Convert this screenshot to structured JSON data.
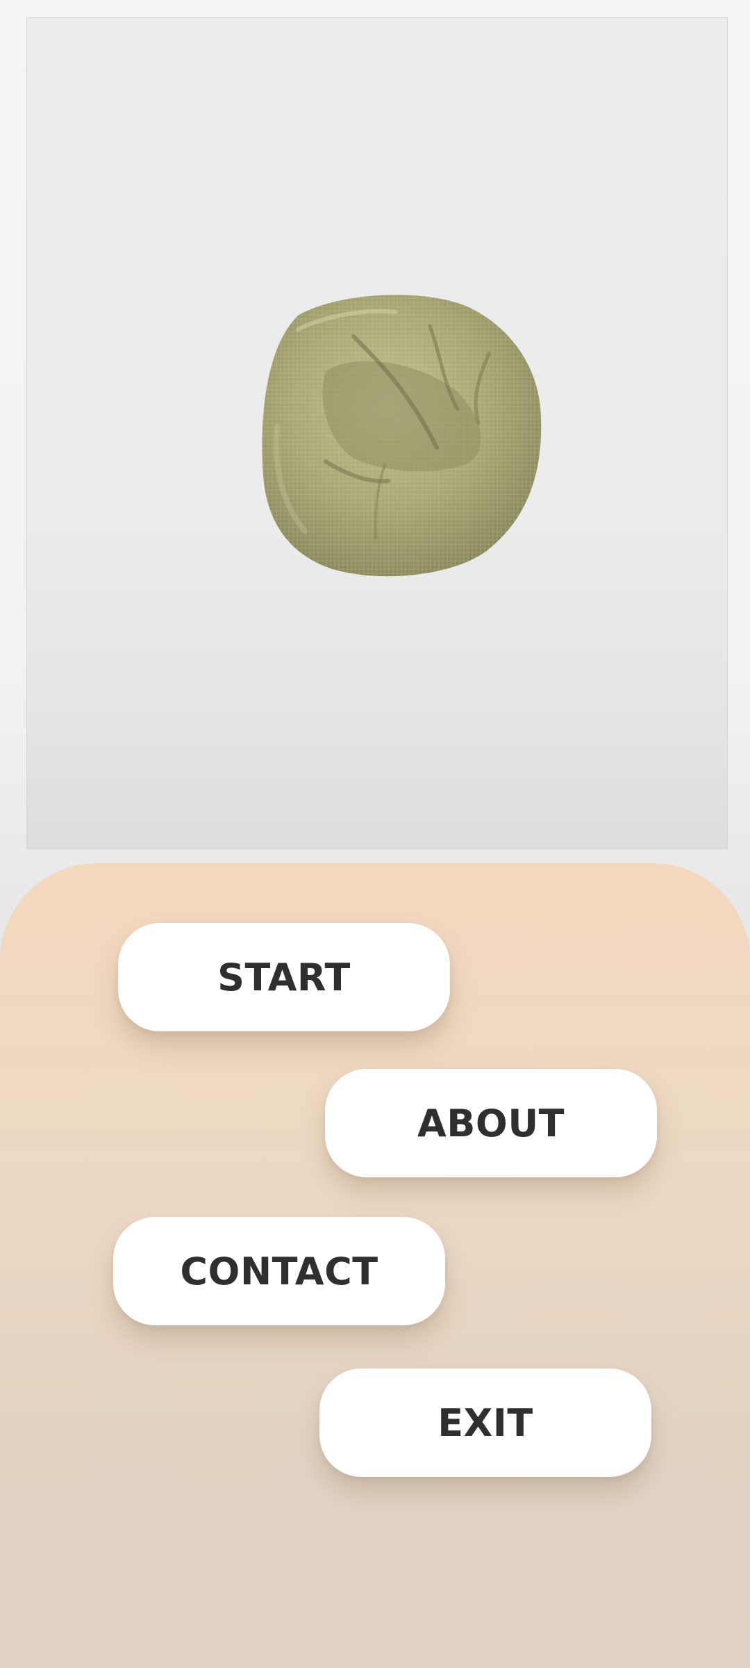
{
  "hero": {
    "image": "green-bean-bag-chair"
  },
  "menu": {
    "start_label": "START",
    "about_label": "ABOUT",
    "contact_label": "CONTACT",
    "exit_label": "EXIT"
  },
  "colors": {
    "panel_top": "#f4d8be",
    "panel_bottom": "#e0d2c5",
    "button_bg": "#ffffff",
    "button_text": "#2f2f2f",
    "bean_bag": "#a9a877"
  }
}
